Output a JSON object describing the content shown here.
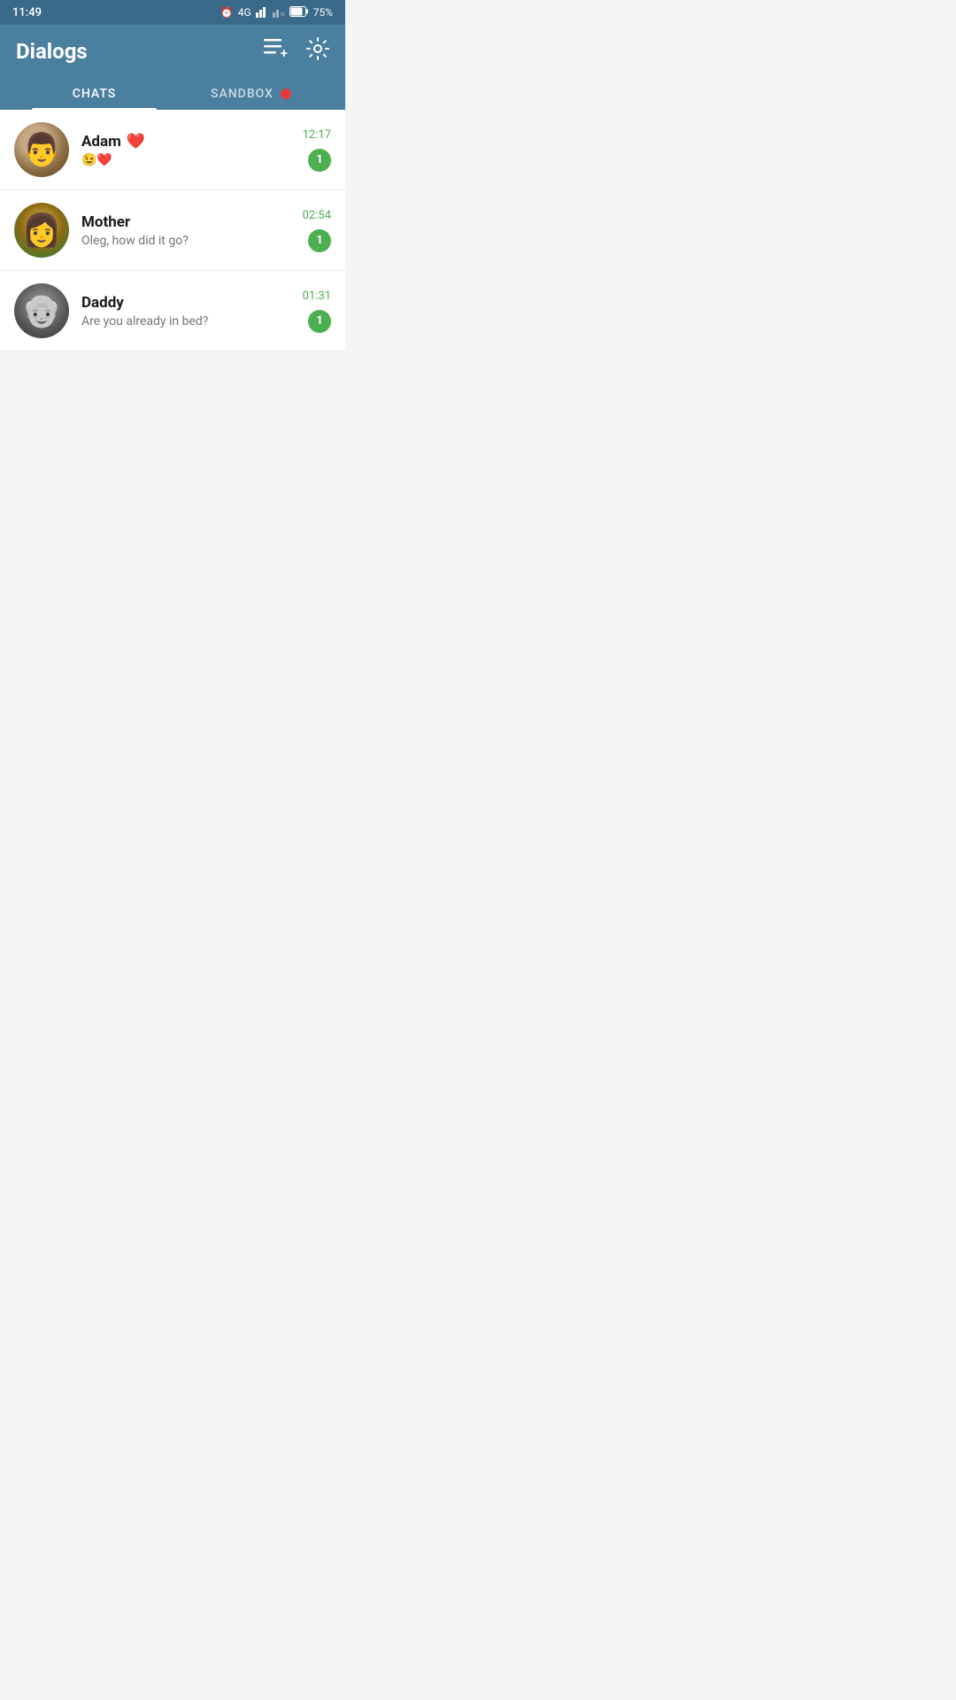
{
  "statusBar": {
    "time": "11:49",
    "battery": "75%",
    "network": "4G"
  },
  "header": {
    "title": "Dialogs",
    "newChatIcon": "new-chat-icon",
    "settingsIcon": "settings-icon"
  },
  "tabs": [
    {
      "label": "CHATS",
      "active": true,
      "hasDot": false
    },
    {
      "label": "SANDBOX",
      "active": false,
      "hasDot": true
    }
  ],
  "chats": [
    {
      "id": "adam",
      "name": "Adam",
      "nameEmoji": "❤️",
      "preview": "😉❤️",
      "time": "12:17",
      "unread": 1,
      "avatarClass": "avatar-adam"
    },
    {
      "id": "mother",
      "name": "Mother",
      "nameEmoji": "",
      "preview": "Oleg, how did it go?",
      "time": "02:54",
      "unread": 1,
      "avatarClass": "avatar-mother"
    },
    {
      "id": "daddy",
      "name": "Daddy",
      "nameEmoji": "",
      "preview": "Are you already in bed?",
      "time": "01:31",
      "unread": 1,
      "avatarClass": "avatar-daddy"
    }
  ]
}
